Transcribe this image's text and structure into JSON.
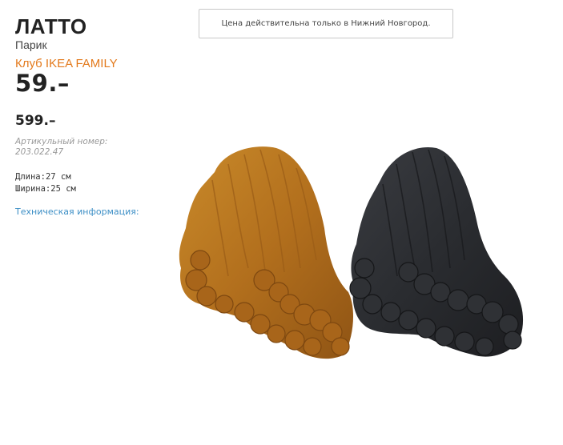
{
  "product": {
    "name": "ЛАТТО",
    "type": "Парик",
    "family_label": "Клуб IKEA FAMILY",
    "family_price": "59.–",
    "regular_price": "599.–",
    "article_label": "Артикульный номер:",
    "article_number": "203.022.47",
    "length_label": "Длина:",
    "length_value": "27 см",
    "width_label": "Ширина:",
    "width_value": "25 см",
    "tech_info_link": "Техническая информация:"
  },
  "notice": "Цена действительна только в Нижний Новгород.",
  "colors": {
    "accent": "#e3791b",
    "link": "#3d8fc6",
    "wig_orange": "#b8701c",
    "wig_black": "#2b2d31"
  }
}
